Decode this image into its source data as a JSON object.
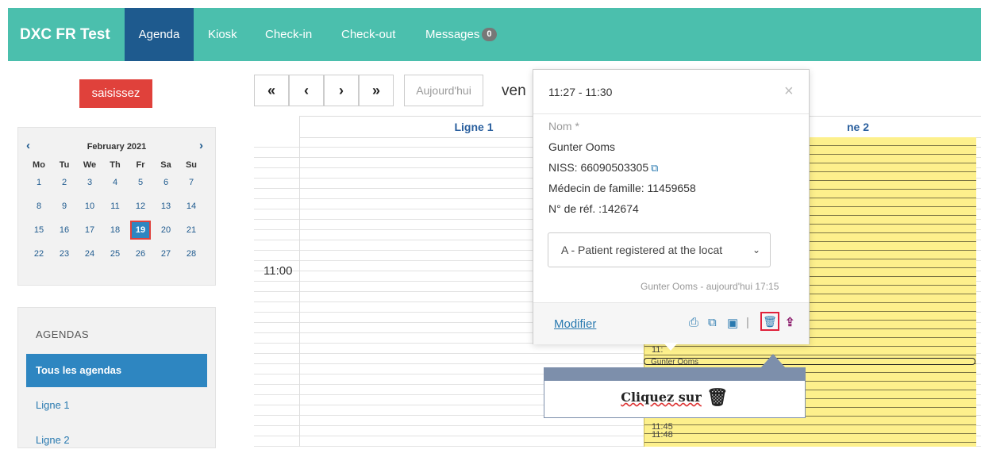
{
  "nav": {
    "brand": "DXC FR Test",
    "tabs": [
      "Agenda",
      "Kiosk",
      "Check-in",
      "Check-out",
      "Messages"
    ],
    "messages_count": "0"
  },
  "sidebar": {
    "new_button": "saisissez",
    "calendar": {
      "month": "February 2021",
      "weekdays": [
        "Mo",
        "Tu",
        "We",
        "Th",
        "Fr",
        "Sa",
        "Su"
      ],
      "weeks": [
        [
          "1",
          "2",
          "3",
          "4",
          "5",
          "6",
          "7"
        ],
        [
          "8",
          "9",
          "10",
          "11",
          "12",
          "13",
          "14"
        ],
        [
          "15",
          "16",
          "17",
          "18",
          "19",
          "20",
          "21"
        ],
        [
          "22",
          "23",
          "24",
          "25",
          "26",
          "27",
          "28"
        ]
      ],
      "selected": "19"
    },
    "agendas": {
      "title": "AGENDAS",
      "items": [
        "Tous les agendas",
        "Ligne 1",
        "Ligne 2"
      ]
    }
  },
  "toolbar": {
    "first": "«",
    "prev": "‹",
    "next": "›",
    "last": "»",
    "today": "Aujourd'hui",
    "date_title": "ven"
  },
  "grid": {
    "columns": [
      "Ligne 1",
      "ne 2"
    ],
    "time_label": "11:00",
    "slot_times_top": "11:",
    "patient_label": "Gunter Ooms",
    "slot_times_bottom": [
      "11:45",
      "11:48"
    ]
  },
  "popover": {
    "time": "11:27 - 11:30",
    "close": "×",
    "name_label": "Nom *",
    "name": "Gunter Ooms",
    "niss": "NISS: 66090503305",
    "doctor": "Médecin de famille: 11459658",
    "ref": "N° de réf. :142674",
    "status_select": "A - Patient registered at the locat",
    "meta": "Gunter Ooms - aujourd'hui 17:15",
    "edit_link": "Modifier"
  },
  "callout": {
    "text": "Cliquez sur"
  },
  "colors": {
    "nav_bg": "#4bbfad",
    "nav_active": "#1e5a8e",
    "button_red": "#e0413b",
    "accent_blue": "#2e86c1",
    "slot_yellow": "#fdf08c",
    "callout_grey": "#7d8fab"
  }
}
